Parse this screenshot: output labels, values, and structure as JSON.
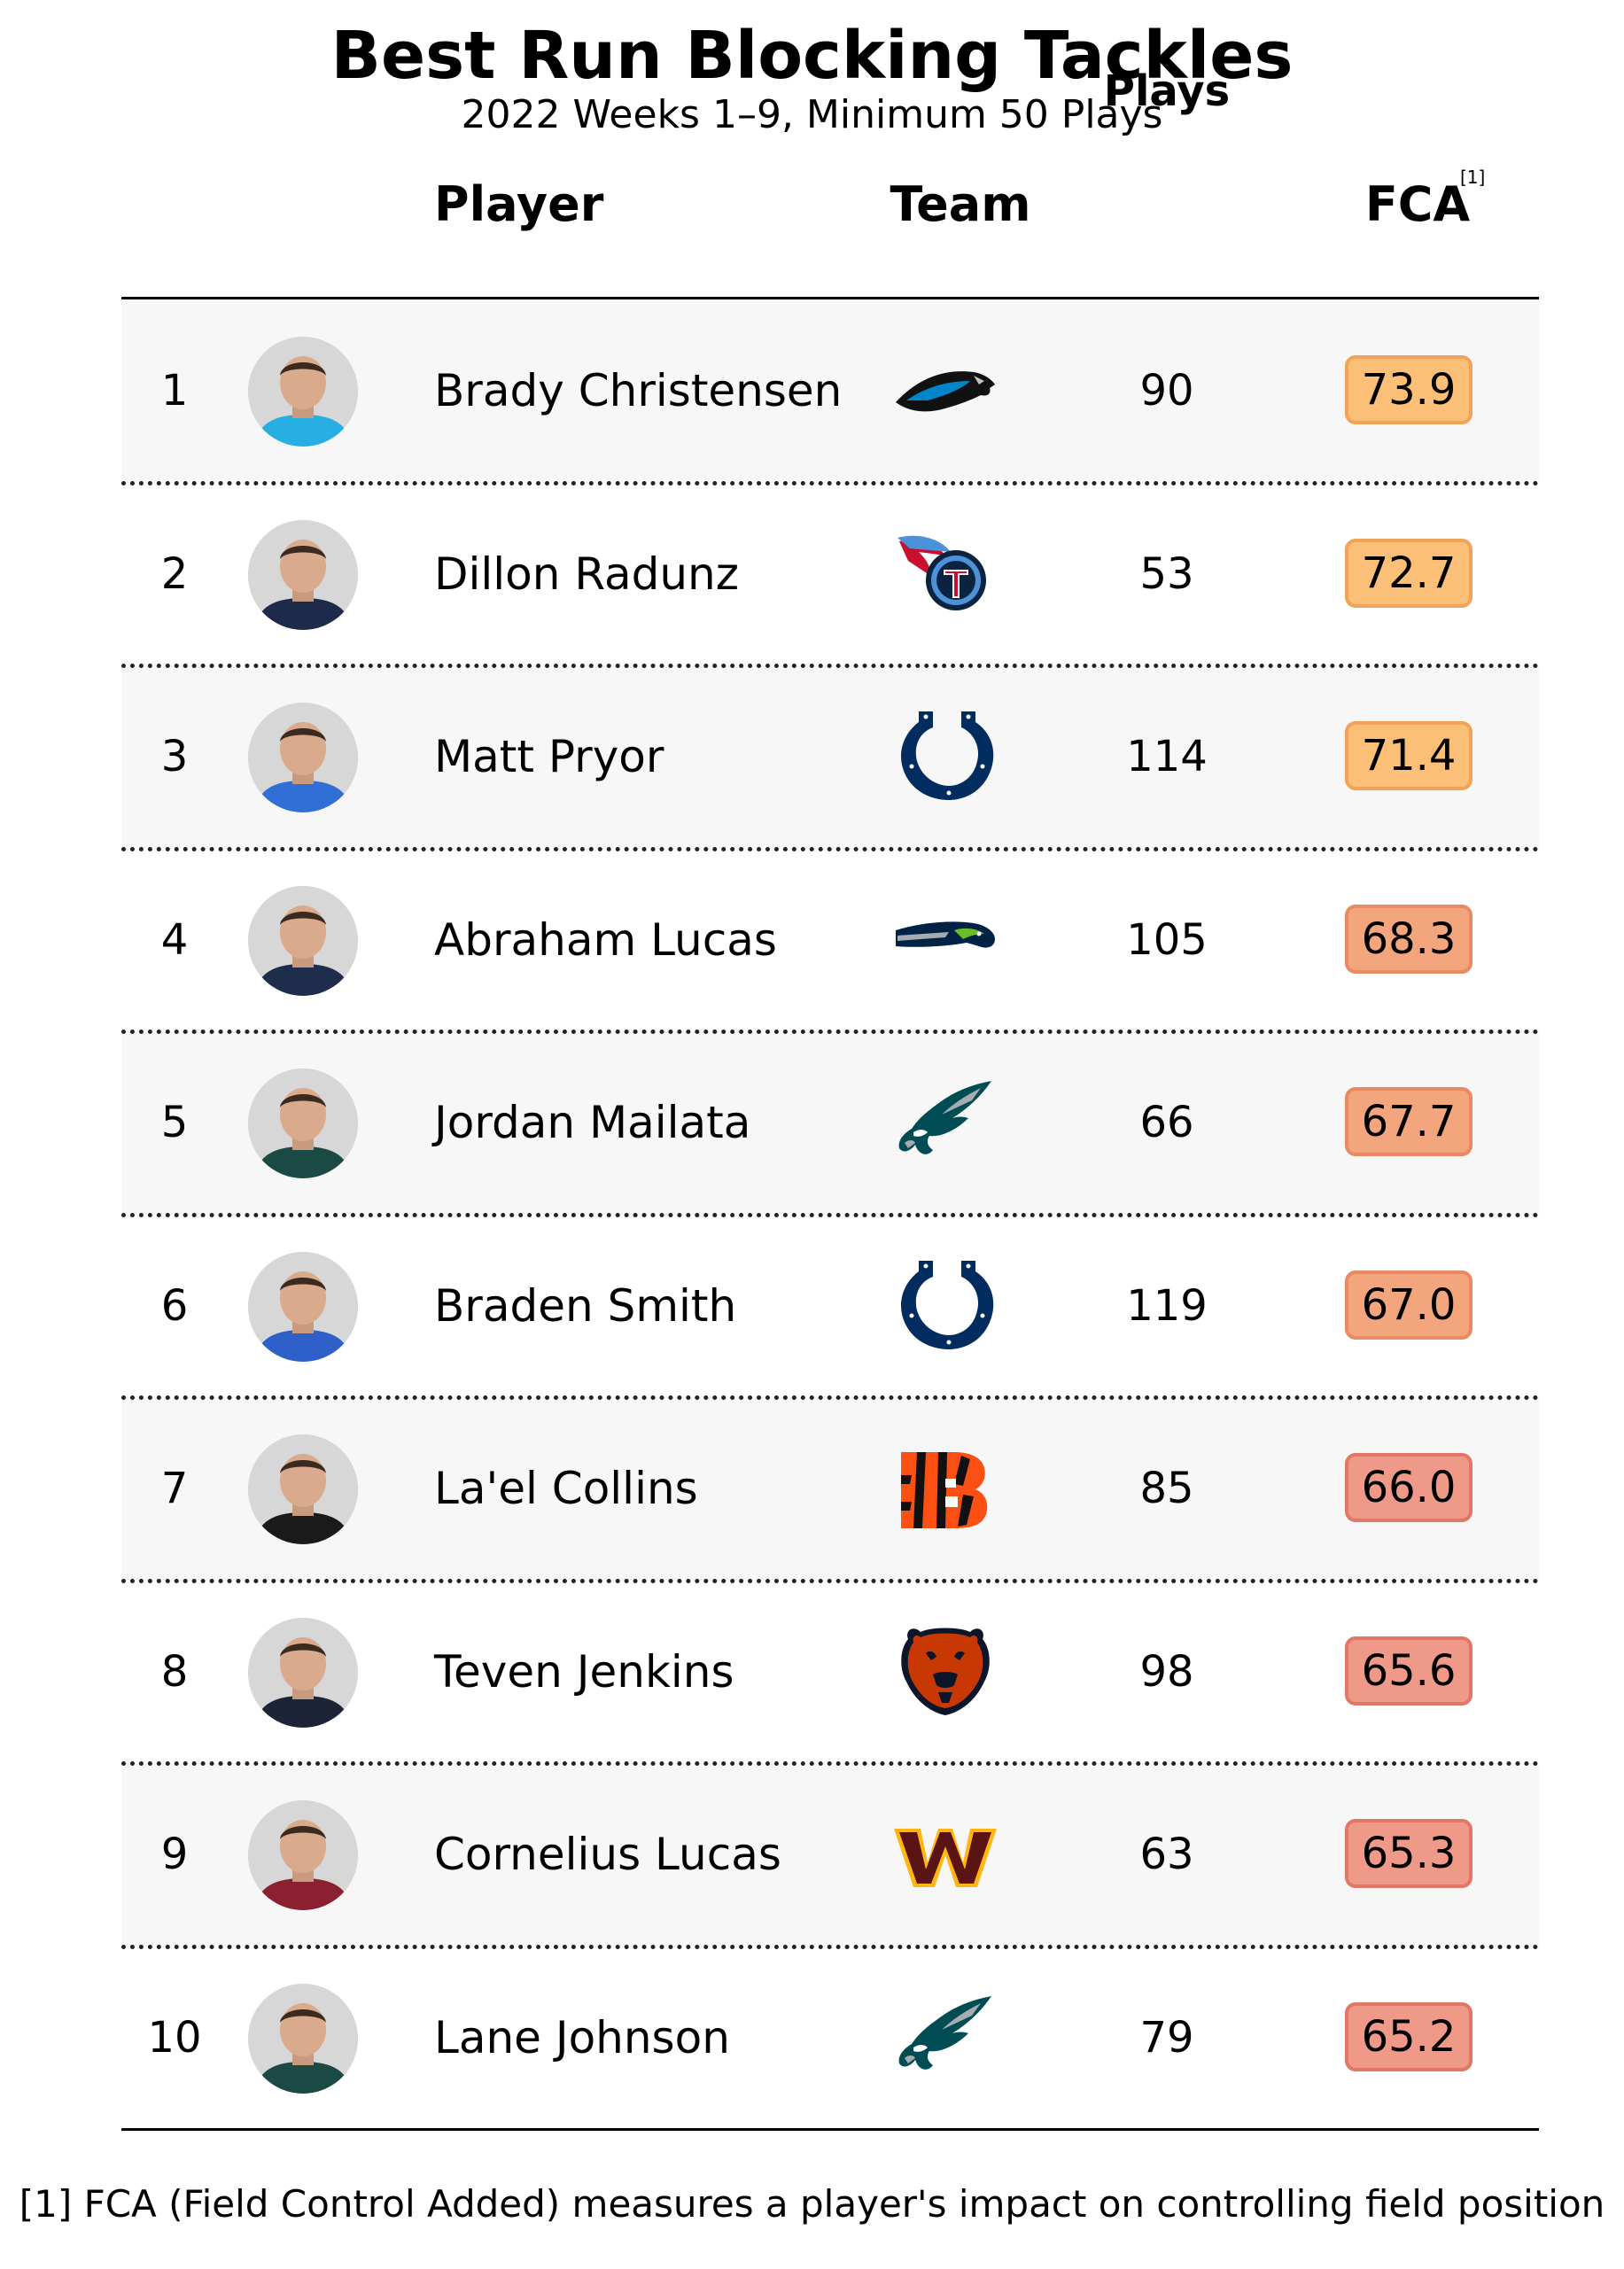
{
  "header": {
    "title": "Best Run Blocking Tackles",
    "subtitle": "2022 Weeks 1–9, Minimum 50 Plays",
    "col_player": "Player",
    "col_team": "Team",
    "col_plays": "Plays",
    "col_fca": "FCA",
    "fca_ref": "[1]"
  },
  "footnote": "[1] FCA (Field Control Added) measures a player's impact on controlling field position",
  "colors": {
    "row_shade": "#f7f7f7",
    "fca_high_fill": "#fbbf77",
    "fca_high_border": "#f2a35a",
    "fca_mid_fill": "#f3a57e",
    "fca_mid_border": "#e98a63",
    "fca_low_fill": "#ef9a88",
    "fca_low_border": "#e17866"
  },
  "chart_data": {
    "type": "table",
    "columns": [
      "",
      "",
      "Player",
      "Team",
      "Plays",
      "FCA"
    ],
    "rows": [
      {
        "rank": "1",
        "player": "Brady Christensen",
        "team": "carolina-panthers-logo",
        "plays": "90",
        "fca": "73.9",
        "jersey": "#27aee3"
      },
      {
        "rank": "2",
        "player": "Dillon Radunz",
        "team": "tennessee-titans-logo",
        "plays": "53",
        "fca": "72.7",
        "jersey": "#1e2a4a"
      },
      {
        "rank": "3",
        "player": "Matt Pryor",
        "team": "indianapolis-colts-logo",
        "plays": "114",
        "fca": "71.4",
        "jersey": "#2f6fd6"
      },
      {
        "rank": "4",
        "player": "Abraham Lucas",
        "team": "seattle-seahawks-logo",
        "plays": "105",
        "fca": "68.3",
        "jersey": "#1f2d4d"
      },
      {
        "rank": "5",
        "player": "Jordan Mailata",
        "team": "philadelphia-eagles-logo",
        "plays": "66",
        "fca": "67.7",
        "jersey": "#1b4a44"
      },
      {
        "rank": "6",
        "player": "Braden Smith",
        "team": "indianapolis-colts-logo",
        "plays": "119",
        "fca": "67.0",
        "jersey": "#2f5fc8"
      },
      {
        "rank": "7",
        "player": "La'el Collins",
        "team": "cincinnati-bengals-logo",
        "plays": "85",
        "fca": "66.0",
        "jersey": "#1a1a1a"
      },
      {
        "rank": "8",
        "player": "Teven Jenkins",
        "team": "chicago-bears-logo",
        "plays": "98",
        "fca": "65.6",
        "jersey": "#1e2438"
      },
      {
        "rank": "9",
        "player": "Cornelius Lucas",
        "team": "washington-commanders-logo",
        "plays": "63",
        "fca": "65.3",
        "jersey": "#8b2030"
      },
      {
        "rank": "10",
        "player": "Lane Johnson",
        "team": "philadelphia-eagles-logo",
        "plays": "79",
        "fca": "65.2",
        "jersey": "#1b4a44"
      }
    ]
  }
}
